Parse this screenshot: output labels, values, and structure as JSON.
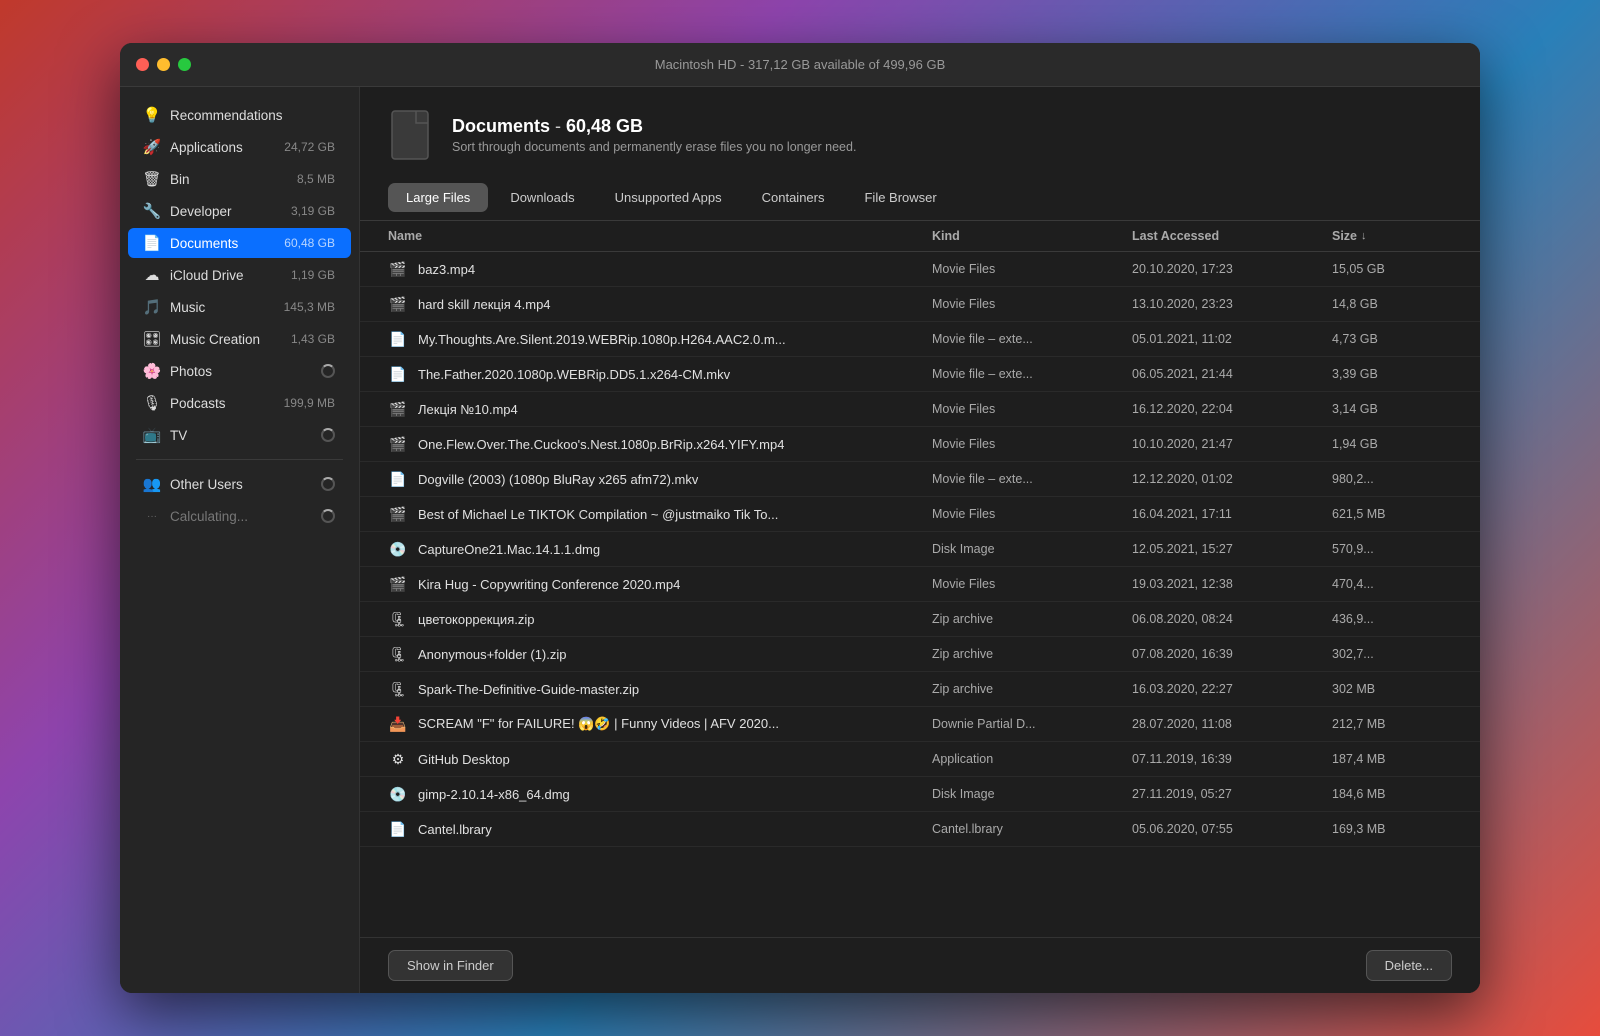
{
  "titlebar": {
    "text": "Macintosh HD - 317,12 GB available of 499,96 GB"
  },
  "sidebar": {
    "items": [
      {
        "id": "recommendations",
        "label": "Recommendations",
        "icon": "💡",
        "size": ""
      },
      {
        "id": "applications",
        "label": "Applications",
        "icon": "🚀",
        "size": "24,72 GB"
      },
      {
        "id": "bin",
        "label": "Bin",
        "icon": "🗑",
        "size": "8,5 MB"
      },
      {
        "id": "developer",
        "label": "Developer",
        "icon": "🔧",
        "size": "3,19 GB"
      },
      {
        "id": "documents",
        "label": "Documents",
        "icon": "📄",
        "size": "60,48 GB",
        "active": true
      },
      {
        "id": "icloud",
        "label": "iCloud Drive",
        "icon": "☁",
        "size": "1,19 GB"
      },
      {
        "id": "music",
        "label": "Music",
        "icon": "🎵",
        "size": "145,3 MB"
      },
      {
        "id": "music-creation",
        "label": "Music Creation",
        "icon": "🎛",
        "size": "1,43 GB"
      },
      {
        "id": "photos",
        "label": "Photos",
        "icon": "🌸",
        "size": "",
        "spinner": true
      },
      {
        "id": "podcasts",
        "label": "Podcasts",
        "icon": "🎙",
        "size": "199,9 MB"
      },
      {
        "id": "tv",
        "label": "TV",
        "icon": "📺",
        "size": "",
        "spinner": true
      }
    ],
    "other_users": {
      "label": "Other Users",
      "icon": "👥",
      "spinner": true
    },
    "calculating": {
      "label": "Calculating...",
      "spinner": true
    }
  },
  "doc_info": {
    "title": "Documents",
    "size": "60,48 GB",
    "subtitle": "Sort through documents and permanently erase files you no longer need."
  },
  "tabs": [
    {
      "id": "large-files",
      "label": "Large Files",
      "active": true
    },
    {
      "id": "downloads",
      "label": "Downloads",
      "active": false
    },
    {
      "id": "unsupported-apps",
      "label": "Unsupported Apps",
      "active": false
    },
    {
      "id": "containers",
      "label": "Containers",
      "active": false
    },
    {
      "id": "file-browser",
      "label": "File Browser",
      "active": false
    }
  ],
  "table": {
    "headers": [
      {
        "id": "name",
        "label": "Name"
      },
      {
        "id": "kind",
        "label": "Kind"
      },
      {
        "id": "last-accessed",
        "label": "Last Accessed"
      },
      {
        "id": "size",
        "label": "Size",
        "sortable": true
      }
    ],
    "rows": [
      {
        "name": "baz3.mp4",
        "kind": "Movie Files",
        "date": "20.10.2020, 17:23",
        "size": "15,05 GB",
        "icon": "🎬"
      },
      {
        "name": "hard skill лекція 4.mp4",
        "kind": "Movie Files",
        "date": "13.10.2020, 23:23",
        "size": "14,8 GB",
        "icon": "🎬"
      },
      {
        "name": "My.Thoughts.Are.Silent.2019.WEBRip.1080p.H264.AAC2.0.m...",
        "kind": "Movie file – exte...",
        "date": "05.01.2021, 11:02",
        "size": "4,73 GB",
        "icon": "📄"
      },
      {
        "name": "The.Father.2020.1080p.WEBRip.DD5.1.x264-CM.mkv",
        "kind": "Movie file – exte...",
        "date": "06.05.2021, 21:44",
        "size": "3,39 GB",
        "icon": "📄"
      },
      {
        "name": "Лекція №10.mp4",
        "kind": "Movie Files",
        "date": "16.12.2020, 22:04",
        "size": "3,14 GB",
        "icon": "🎬"
      },
      {
        "name": "One.Flew.Over.The.Cuckoo's.Nest.1080p.BrRip.x264.YIFY.mp4",
        "kind": "Movie Files",
        "date": "10.10.2020, 21:47",
        "size": "1,94 GB",
        "icon": "🎬"
      },
      {
        "name": "Dogville (2003) (1080p BluRay x265 afm72).mkv",
        "kind": "Movie file – exte...",
        "date": "12.12.2020, 01:02",
        "size": "980,2...",
        "icon": "📄"
      },
      {
        "name": "Best of Michael Le TIKTOK Compilation ~ @justmaiko Tik To...",
        "kind": "Movie Files",
        "date": "16.04.2021, 17:11",
        "size": "621,5 MB",
        "icon": "🎬"
      },
      {
        "name": "CaptureOne21.Mac.14.1.1.dmg",
        "kind": "Disk Image",
        "date": "12.05.2021, 15:27",
        "size": "570,9...",
        "icon": "💿"
      },
      {
        "name": "Kira Hug - Copywriting Conference 2020.mp4",
        "kind": "Movie Files",
        "date": "19.03.2021, 12:38",
        "size": "470,4...",
        "icon": "🎬"
      },
      {
        "name": "цветокоррекция.zip",
        "kind": "Zip archive",
        "date": "06.08.2020, 08:24",
        "size": "436,9...",
        "icon": "🗜"
      },
      {
        "name": "Anonymous+folder (1).zip",
        "kind": "Zip archive",
        "date": "07.08.2020, 16:39",
        "size": "302,7...",
        "icon": "🗜"
      },
      {
        "name": "Spark-The-Definitive-Guide-master.zip",
        "kind": "Zip archive",
        "date": "16.03.2020, 22:27",
        "size": "302 MB",
        "icon": "🗜"
      },
      {
        "name": "SCREAM \"F\" for FAILURE! 😱🤣 | Funny Videos | AFV 2020...",
        "kind": "Downie Partial D...",
        "date": "28.07.2020, 11:08",
        "size": "212,7 MB",
        "icon": "📥"
      },
      {
        "name": "GitHub Desktop",
        "kind": "Application",
        "date": "07.11.2019, 16:39",
        "size": "187,4 MB",
        "icon": "⚙"
      },
      {
        "name": "gimp-2.10.14-x86_64.dmg",
        "kind": "Disk Image",
        "date": "27.11.2019, 05:27",
        "size": "184,6 MB",
        "icon": "💿"
      },
      {
        "name": "Cantel.lbrary",
        "kind": "Cantel.lbrary",
        "date": "05.06.2020, 07:55",
        "size": "169,3 MB",
        "icon": "📄"
      }
    ]
  },
  "footer": {
    "show_in_finder": "Show in Finder",
    "delete": "Delete..."
  }
}
